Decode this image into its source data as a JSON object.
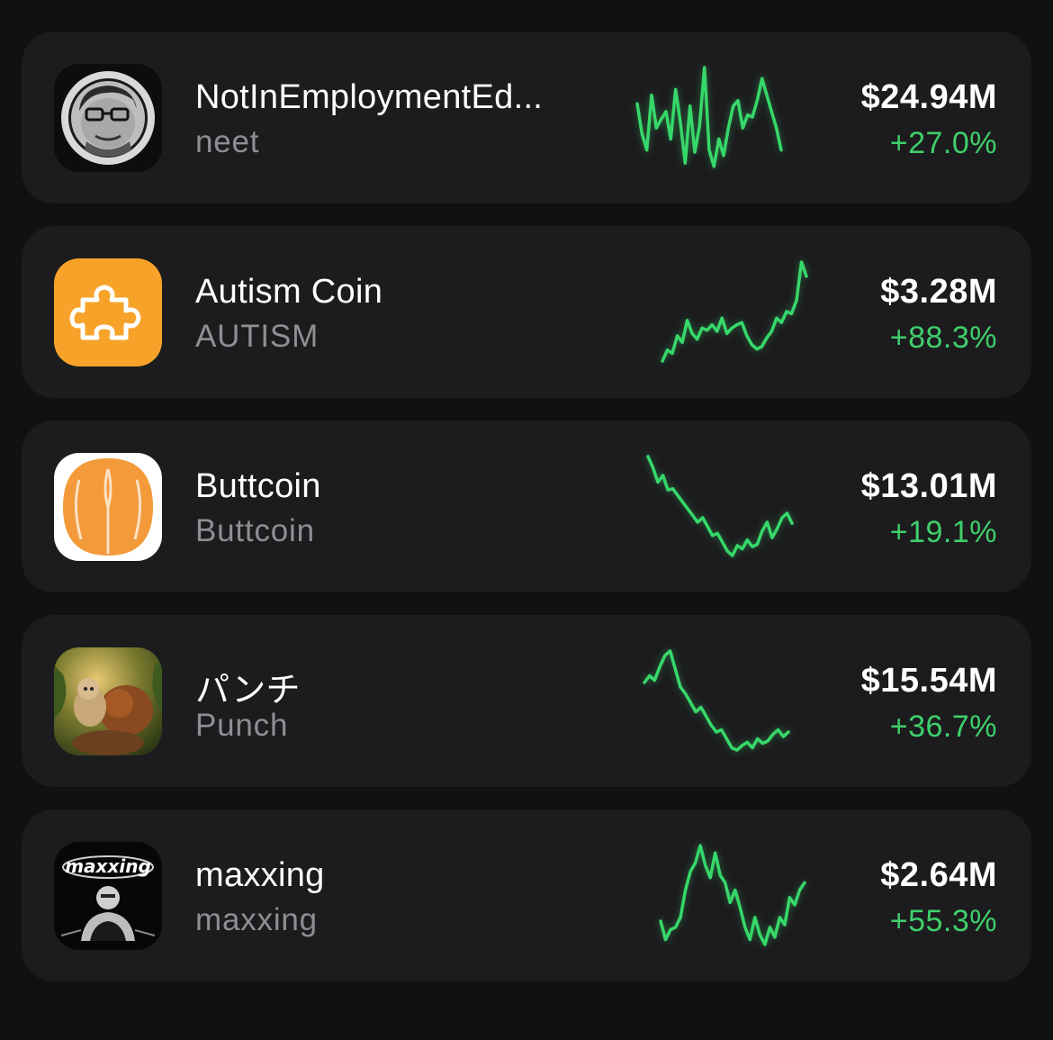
{
  "theme": {
    "background": "#111112",
    "card": "#1c1c1e",
    "positive": "#3fcf6b",
    "sparkline": "#37d86a",
    "muted": "#8e8e93"
  },
  "tokens": [
    {
      "name": "NotInEmploymentEd...",
      "ticker": "neet",
      "market_cap": "$24.94M",
      "change": "+27.0%",
      "icon": "cartoon-man-avatar-icon",
      "sparkline": [
        62,
        35,
        20,
        70,
        40,
        48,
        55,
        30,
        75,
        45,
        8,
        60,
        18,
        42,
        95,
        20,
        5,
        30,
        15,
        40,
        60,
        65,
        40,
        52,
        50,
        65,
        85,
        70,
        55,
        40,
        20
      ]
    },
    {
      "name": "Autism Coin",
      "ticker": "AUTISM",
      "market_cap": "$3.28M",
      "change": "+88.3%",
      "icon": "puzzle-piece-icon",
      "sparkline": [
        5,
        15,
        12,
        28,
        22,
        42,
        30,
        25,
        35,
        33,
        38,
        32,
        44,
        30,
        35,
        38,
        40,
        28,
        20,
        16,
        18,
        26,
        32,
        44,
        40,
        50,
        48,
        60,
        95,
        82
      ]
    },
    {
      "name": "Buttcoin",
      "ticker": "Buttcoin",
      "market_cap": "$13.01M",
      "change": "+19.1%",
      "icon": "peach-icon",
      "sparkline": [
        95,
        85,
        72,
        78,
        65,
        66,
        60,
        54,
        48,
        42,
        36,
        40,
        32,
        24,
        26,
        18,
        10,
        6,
        15,
        12,
        20,
        14,
        16,
        28,
        36,
        22,
        30,
        40,
        44,
        35
      ]
    },
    {
      "name": "パンチ",
      "ticker": "Punch",
      "market_cap": "$15.54M",
      "change": "+36.7%",
      "icon": "monkey-photo-icon",
      "sparkline": [
        68,
        74,
        70,
        82,
        92,
        96,
        80,
        64,
        58,
        50,
        42,
        46,
        38,
        30,
        24,
        26,
        18,
        10,
        8,
        12,
        15,
        10,
        18,
        14,
        16,
        22,
        26,
        20,
        24
      ]
    },
    {
      "name": "maxxing",
      "ticker": "maxxing",
      "market_cap": "$2.64M",
      "change": "+55.3%",
      "icon": "maxxing-logo-icon",
      "sparkline": [
        35,
        20,
        28,
        30,
        38,
        60,
        75,
        82,
        96,
        80,
        70,
        90,
        72,
        66,
        50,
        60,
        46,
        30,
        20,
        38,
        24,
        16,
        30,
        22,
        38,
        32,
        54,
        48,
        60,
        66
      ]
    }
  ]
}
